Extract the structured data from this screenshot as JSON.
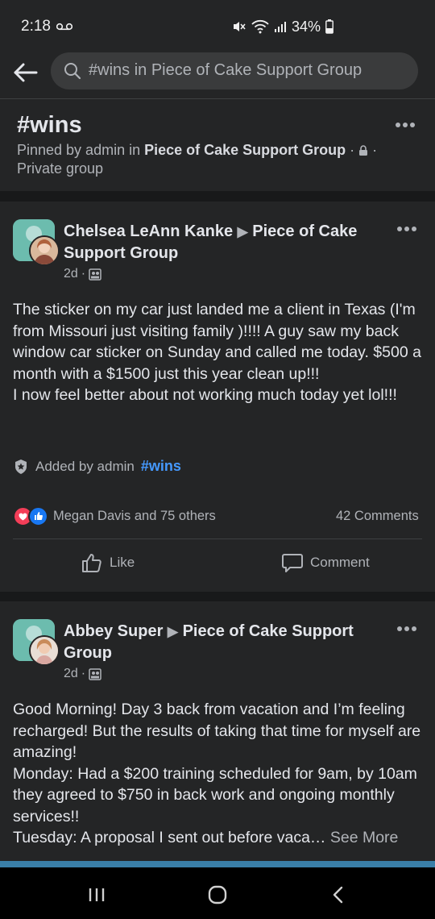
{
  "status_bar": {
    "time": "2:18",
    "battery": "34%"
  },
  "search": {
    "query": "#wins in Piece of Cake Support Group"
  },
  "hashtag": {
    "title": "#wins",
    "pinned_prefix": "Pinned by admin in ",
    "group_name": "Piece of Cake Support Group",
    "privacy": "Private group"
  },
  "posts": [
    {
      "author": "Chelsea LeAnn Kanke",
      "group": "Piece of Cake Support Group",
      "time": "2d",
      "body": "The sticker on my car just landed me a client in Texas (I'm from Missouri just visiting family )!!!! A guy saw my back window car sticker on Sunday and called me today. $500 a month with a $1500 just this year clean up!!!\nI now feel better about not working much today yet lol!!!",
      "added_by": "Added by admin",
      "tag": "#wins",
      "reactions": "Megan Davis and 75 others",
      "comments": "42 Comments",
      "like_label": "Like",
      "comment_label": "Comment"
    },
    {
      "author": "Abbey Super",
      "group": "Piece of Cake Support Group",
      "time": "2d",
      "body": "Good Morning! Day 3 back from vacation and I’m feeling recharged! But the results of taking that time for myself are amazing!\nMonday: Had a $200 training scheduled for 9am, by 10am they agreed to $750 in back work and ongoing monthly services!!\nTuesday: A proposal I sent out before vaca… ",
      "see_more": "See More"
    }
  ],
  "colors": {
    "background": "#18191a",
    "card": "#242526",
    "link_blue": "#4599ff",
    "like_blue": "#1877f2",
    "heart_red": "#f33e58"
  }
}
